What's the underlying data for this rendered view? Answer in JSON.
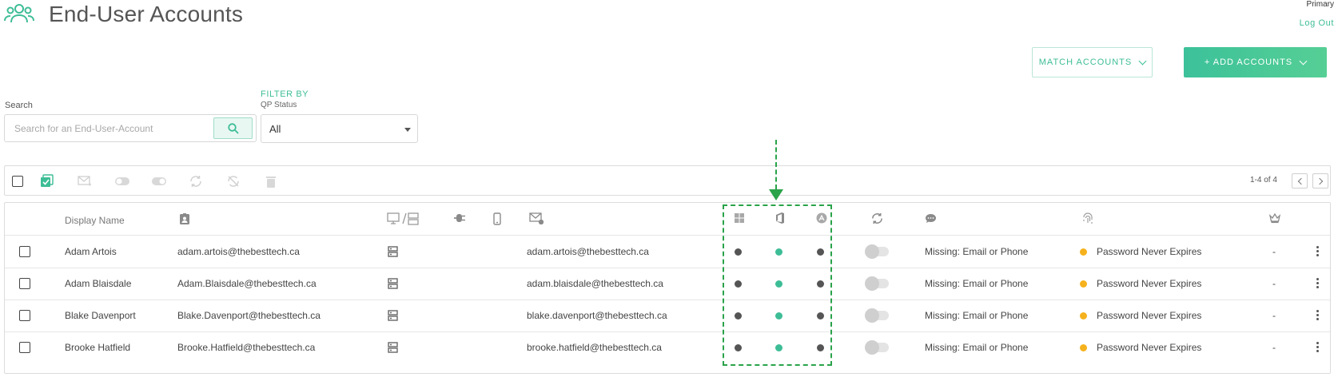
{
  "header": {
    "title": "End-User Accounts",
    "user_role": "Primary",
    "logout_label": "Log Out"
  },
  "actions": {
    "match_label": "MATCH ACCOUNTS",
    "add_label": "+ ADD ACCOUNTS"
  },
  "search": {
    "label": "Search",
    "placeholder": "Search for an End-User-Account"
  },
  "filter": {
    "title": "FILTER BY",
    "subtitle": "QP Status",
    "value": "All"
  },
  "pagination": {
    "text": "1-4 of 4"
  },
  "table": {
    "columns": {
      "display_name": "Display Name"
    },
    "rows": [
      {
        "name": "Adam Artois",
        "upn": "adam.artois@thebesttech.ca",
        "email": "adam.artois@thebesttech.ca",
        "missing": "Missing: Email or Phone",
        "password": "Password Never Expires",
        "last": "-"
      },
      {
        "name": "Adam Blaisdale",
        "upn": "Adam.Blaisdale@thebesttech.ca",
        "email": "adam.blaisdale@thebesttech.ca",
        "missing": "Missing: Email or Phone",
        "password": "Password Never Expires",
        "last": "-"
      },
      {
        "name": "Blake Davenport",
        "upn": "Blake.Davenport@thebesttech.ca",
        "email": "blake.davenport@thebesttech.ca",
        "missing": "Missing: Email or Phone",
        "password": "Password Never Expires",
        "last": "-"
      },
      {
        "name": "Brooke Hatfield",
        "upn": "Brooke.Hatfield@thebesttech.ca",
        "email": "brooke.hatfield@thebesttech.ca",
        "missing": "Missing: Email or Phone",
        "password": "Password Never Expires",
        "last": "-"
      }
    ]
  },
  "colors": {
    "accent": "#3dbd96",
    "dot_dark": "#555555",
    "dot_green": "#3dbd96",
    "warning": "#f5b21d",
    "annotation": "#2aa34a"
  },
  "icons": {
    "title": "users-icon",
    "search": "search-icon",
    "toolbar": [
      "select-all-checkbox",
      "bulk-select-icon",
      "send-email-icon",
      "toggle-on-icon",
      "toggle-off-icon",
      "sync-icon",
      "sync-disabled-icon",
      "delete-icon"
    ],
    "columns": [
      "id-badge-icon",
      "device-server-icon",
      "plug-icon",
      "phone-icon",
      "email-icon",
      "windows-icon",
      "office-icon",
      "azure-icon",
      "sync-icon",
      "chat-icon",
      "fingerprint-icon",
      "crown-icon"
    ]
  }
}
